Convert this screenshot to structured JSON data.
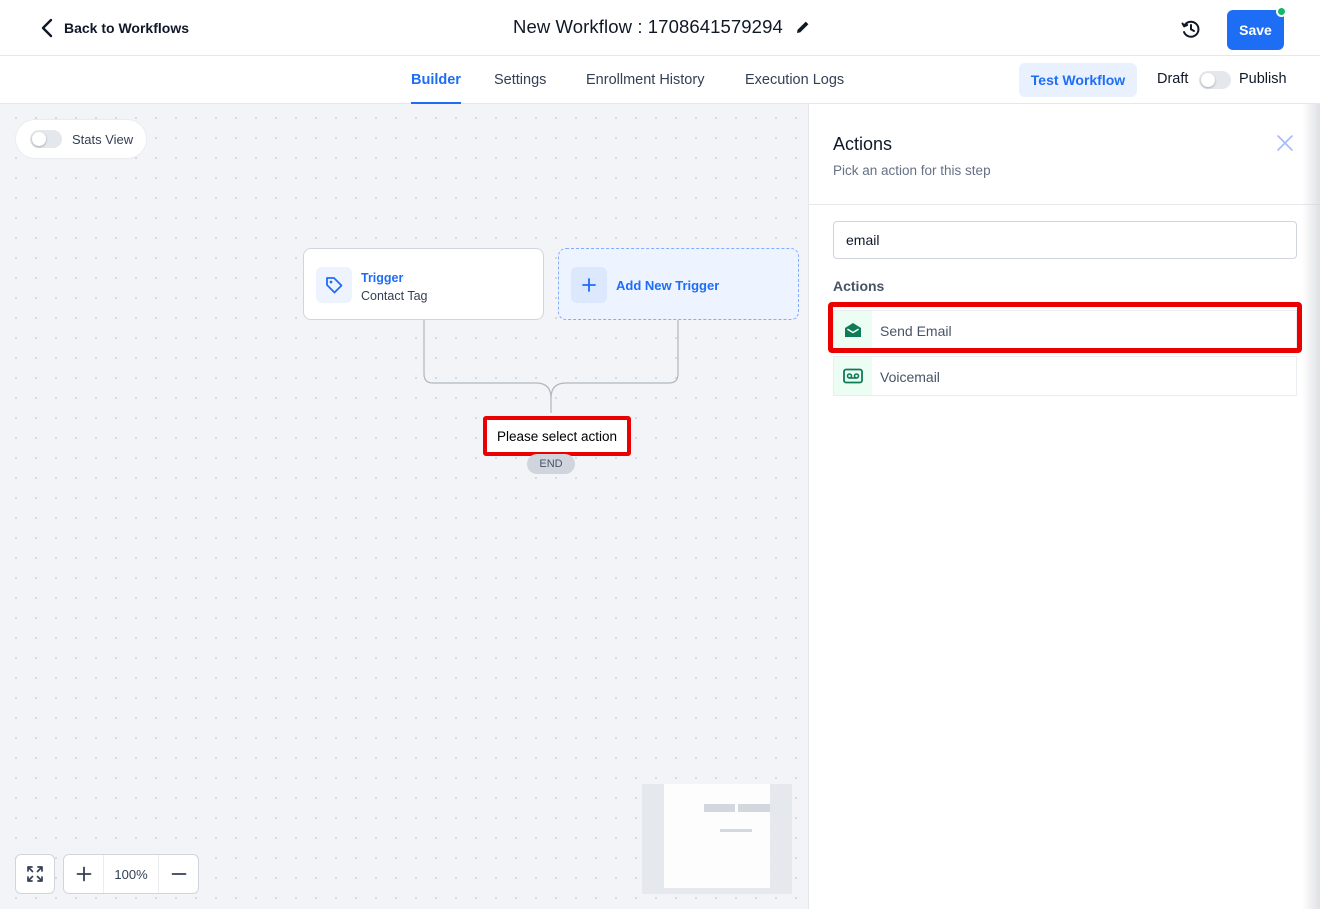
{
  "header": {
    "back_label": "Back to Workflows",
    "workflow_title": "New Workflow : 1708641579294",
    "save_label": "Save"
  },
  "tabs": [
    {
      "label": "Builder",
      "active": true
    },
    {
      "label": "Settings",
      "active": false
    },
    {
      "label": "Enrollment History",
      "active": false
    },
    {
      "label": "Execution Logs",
      "active": false
    }
  ],
  "toolbar": {
    "test_workflow_label": "Test Workflow",
    "draft_label": "Draft",
    "publish_label": "Publish",
    "published": false
  },
  "canvas": {
    "stats_view_label": "Stats View",
    "stats_view_enabled": false,
    "trigger": {
      "title": "Trigger",
      "subtitle": "Contact Tag"
    },
    "add_trigger_label": "Add New Trigger",
    "select_action_label": "Please select action",
    "end_label": "END",
    "zoom_level": "100%"
  },
  "panel": {
    "title": "Actions",
    "subtitle": "Pick an action for this step",
    "search_value": "email",
    "section_label": "Actions",
    "items": [
      {
        "label": "Send Email",
        "icon": "envelope-open-icon",
        "highlighted": true
      },
      {
        "label": "Voicemail",
        "icon": "voicemail-icon",
        "highlighted": false
      }
    ]
  },
  "colors": {
    "accent": "#1e6ef5",
    "highlight_red": "#ea0000",
    "action_icon_green": "#0e7c57",
    "status_dot": "#12b76a"
  }
}
